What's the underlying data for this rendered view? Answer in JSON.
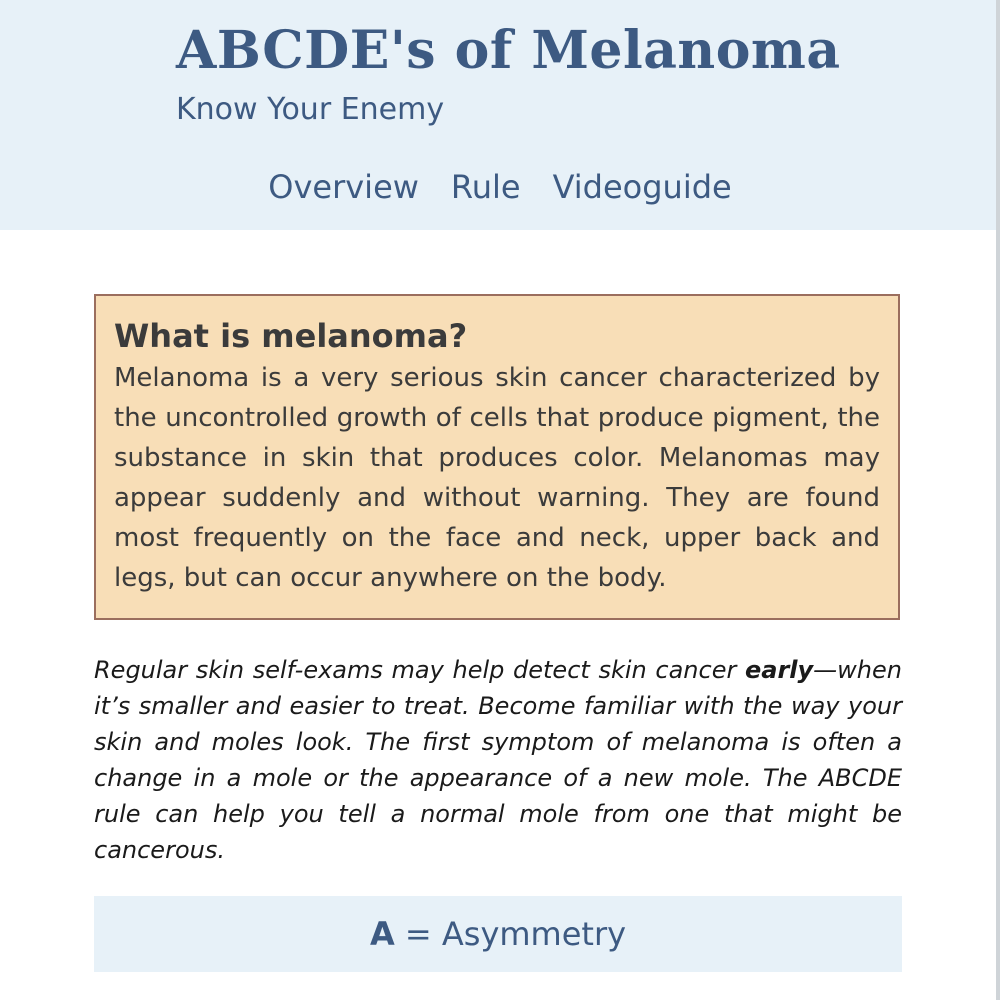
{
  "header": {
    "title": "ABCDE's of Melanoma",
    "tagline": "Know Your Enemy",
    "nav": [
      {
        "label": "Overview"
      },
      {
        "label": "Rule"
      },
      {
        "label": "Videoguide"
      }
    ]
  },
  "info_box": {
    "heading": "What is melanoma?",
    "text": "Melanoma is a very serious skin cancer characterized by the uncontrolled growth of cells that produce pigment, the substance in skin that produces color. Melanomas may appear suddenly and without warning. They are found most frequently on the face and neck, upper back and legs, but can occur anywhere on the body."
  },
  "intro": {
    "before": "Regular skin self-exams may help detect skin cancer ",
    "emphasis": "early",
    "after": "—when it’s smaller and easier to treat. Become familiar with the way your skin and moles look. The first symptom of melanoma is often a change in a mole or the appearance of a new mole. The ABCDE rule can help you tell a normal mole from one that might be cancerous."
  },
  "rules": [
    {
      "letter": "A",
      "separator": " = ",
      "name": "Asymmetry"
    }
  ],
  "colors": {
    "header_bg": "#e7f1f8",
    "accent": "#3d5a82",
    "info_bg": "#f8deb7",
    "info_border": "#9b6e5e"
  }
}
